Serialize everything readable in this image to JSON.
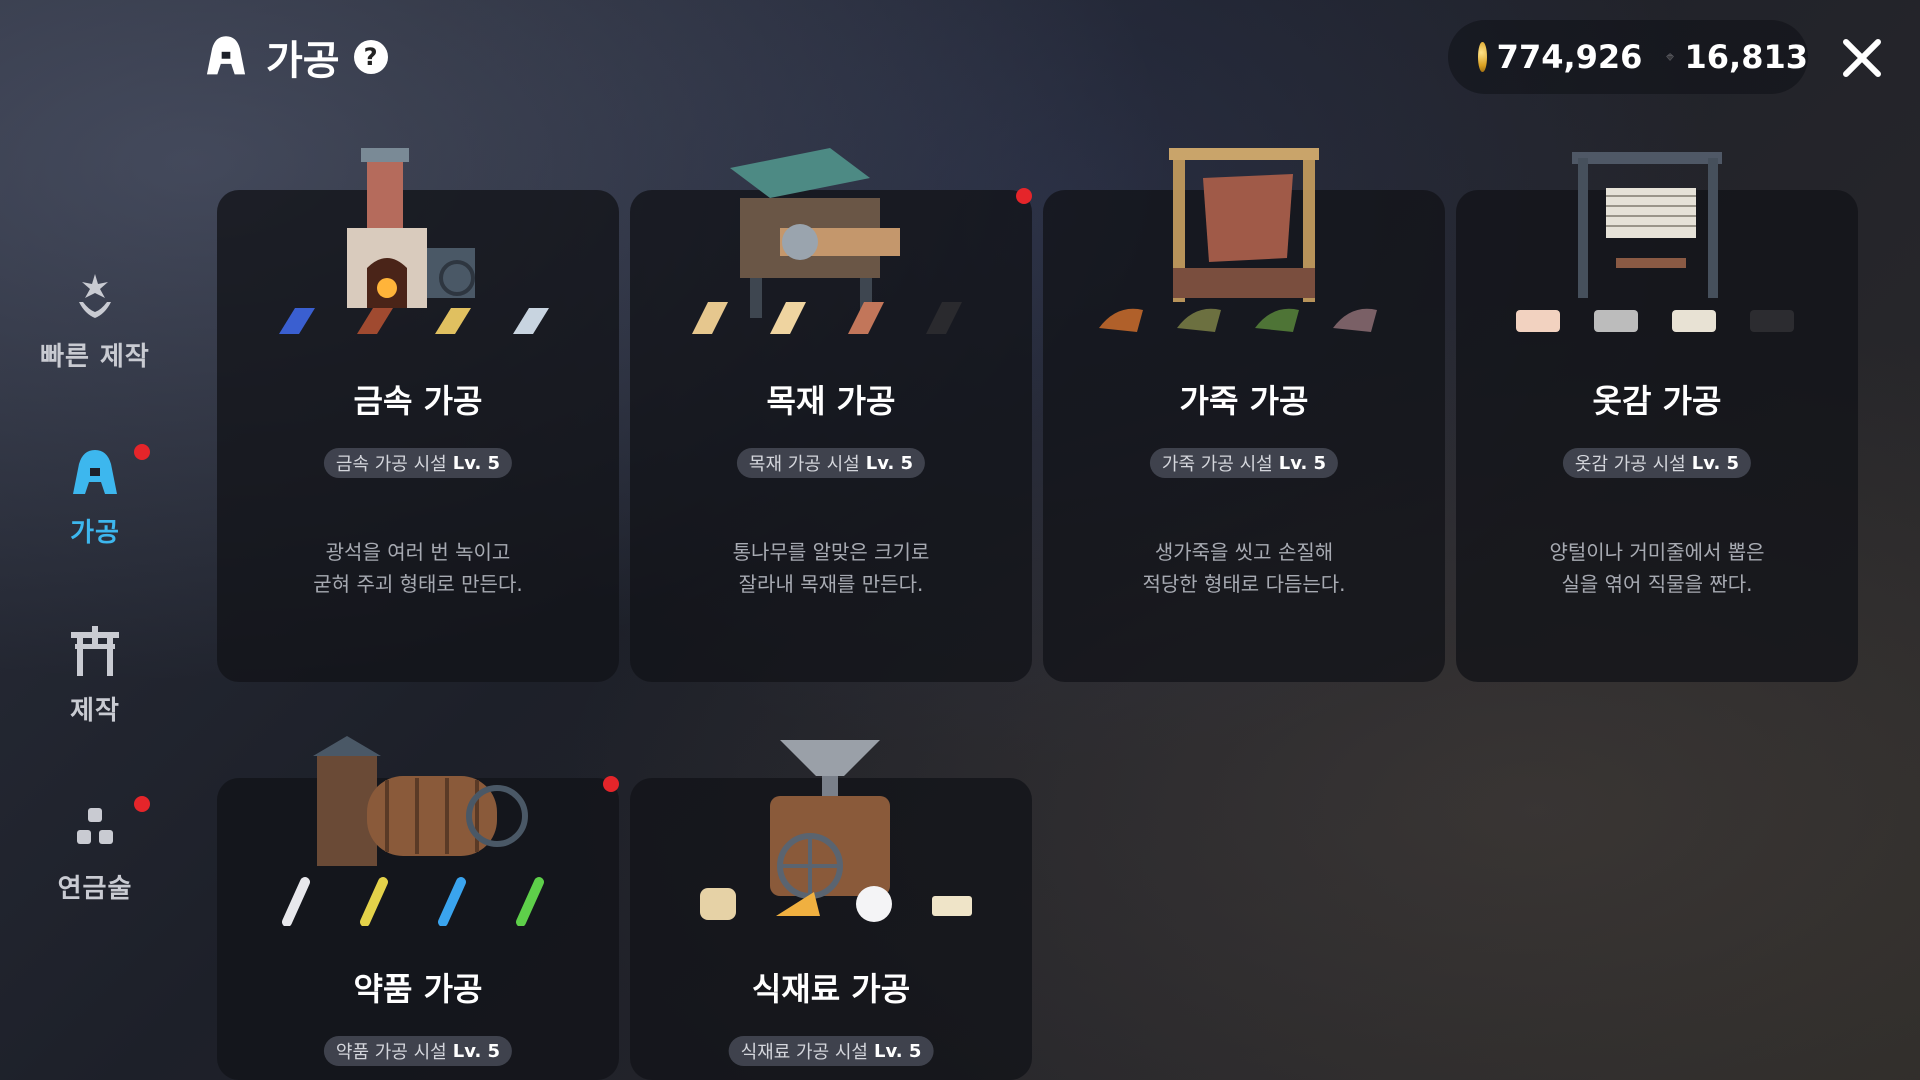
{
  "header": {
    "title": "가공",
    "help_icon": "question-icon",
    "title_icon": "processing-icon"
  },
  "currency": {
    "gold": "774,926",
    "gem": "16,813"
  },
  "sidebar": {
    "items": [
      {
        "label": "빠른 제작",
        "icon": "sparkle-hand-icon",
        "active": false,
        "badge": false
      },
      {
        "label": "가공",
        "icon": "processing-icon",
        "active": true,
        "badge": true
      },
      {
        "label": "제작",
        "icon": "gate-icon",
        "active": false,
        "badge": false
      },
      {
        "label": "연금술",
        "icon": "blocks-icon",
        "active": false,
        "badge": true
      }
    ]
  },
  "cards": [
    {
      "title": "금속 가공",
      "facility": "금속 가공 시설",
      "level": "Lv. 5",
      "desc1": "광석을 여러 번 녹이고",
      "desc2": "굳혀 주괴 형태로 만든다.",
      "badge": false
    },
    {
      "title": "목재 가공",
      "facility": "목재 가공 시설",
      "level": "Lv. 5",
      "desc1": "통나무를 알맞은 크기로",
      "desc2": "잘라내 목재를 만든다.",
      "badge": true
    },
    {
      "title": "가죽 가공",
      "facility": "가죽 가공 시설",
      "level": "Lv. 5",
      "desc1": "생가죽을 씻고 손질해",
      "desc2": "적당한 형태로 다듬는다.",
      "badge": false
    },
    {
      "title": "옷감 가공",
      "facility": "옷감 가공 시설",
      "level": "Lv. 5",
      "desc1": "양털이나 거미줄에서 뽑은",
      "desc2": "실을 엮어 직물을 짠다.",
      "badge": false
    },
    {
      "title": "약품 가공",
      "facility": "약품 가공 시설",
      "level": "Lv. 5",
      "desc1": "",
      "desc2": "",
      "badge": true
    },
    {
      "title": "식재료 가공",
      "facility": "식재료 가공 시설",
      "level": "Lv. 5",
      "desc1": "",
      "desc2": "",
      "badge": false
    }
  ],
  "colors": {
    "accent": "#3db7ee",
    "notify": "#e5252a",
    "card_bg": "#121318"
  }
}
